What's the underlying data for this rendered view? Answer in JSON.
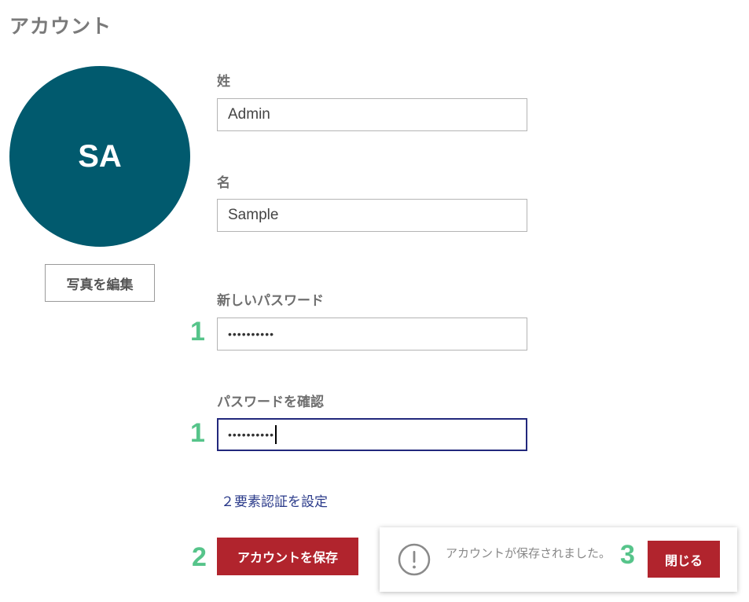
{
  "page": {
    "title": "アカウント"
  },
  "avatar": {
    "initials": "SA",
    "color": "#015a6e",
    "edit_label": "写真を編集"
  },
  "form": {
    "last_name": {
      "label": "姓",
      "value": "Admin"
    },
    "first_name": {
      "label": "名",
      "value": "Sample"
    },
    "new_password": {
      "label": "新しいパスワード",
      "value": "••••••••••"
    },
    "confirm_password": {
      "label": "パスワードを確認",
      "value": "••••••••••"
    },
    "twofa_link": "２要素認証を設定",
    "save_label": "アカウントを保存"
  },
  "steps": {
    "one": "1",
    "two": "2",
    "three": "3",
    "color": "#56c48a"
  },
  "toast": {
    "icon": "exclamation-circle-icon",
    "message": "アカウントが保存されました。",
    "close_label": "閉じる"
  },
  "colors": {
    "primary_button": "#b1242d",
    "focus_border": "#22287c",
    "link": "#2a3a8a"
  }
}
